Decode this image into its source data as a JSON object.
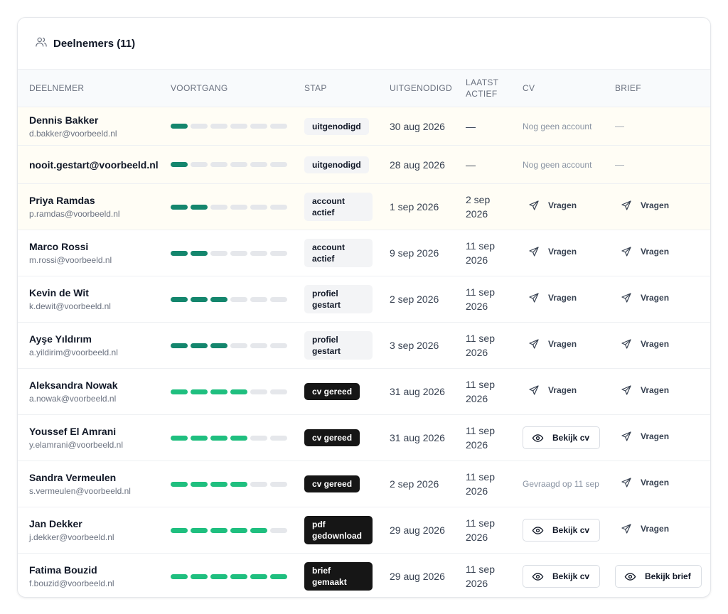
{
  "header": {
    "title": "Deelnemers (11)",
    "icon": "users-icon"
  },
  "columns": {
    "participant": "DEELNEMER",
    "progress": "VOORTGANG",
    "step": "STAP",
    "invited": "UITGENODIGD",
    "last_active_1": "LAATST",
    "last_active_2": "ACTIEF",
    "cv": "CV",
    "letter": "BRIEF"
  },
  "rows": [
    {
      "name": "Dennis Bakker",
      "email": "d.bakker@voorbeeld.nl",
      "progress": 1,
      "step": "uitgenodigd",
      "invited": "30 aug 2026",
      "last_active_1": "—",
      "last_active_2": "",
      "cv": "Nog geen account",
      "letter": "—"
    },
    {
      "name": "nooit.gestart@voorbeeld.nl",
      "email": "",
      "progress": 1,
      "step": "uitgenodigd",
      "invited": "28 aug 2026",
      "last_active_1": "—",
      "last_active_2": "",
      "cv": "Nog geen account",
      "letter": "—"
    },
    {
      "name": "Priya Ramdas",
      "email": "p.ramdas@voorbeeld.nl",
      "progress": 2,
      "step": "account actief",
      "invited": "1 sep 2026",
      "last_active_1": "2 sep",
      "last_active_2": "2026",
      "cv": "Vragen",
      "letter": "Vragen"
    },
    {
      "name": "Marco Rossi",
      "email": "m.rossi@voorbeeld.nl",
      "progress": 2,
      "step": "account actief",
      "invited": "9 sep 2026",
      "last_active_1": "11 sep",
      "last_active_2": "2026",
      "cv": "Vragen",
      "letter": "Vragen"
    },
    {
      "name": "Kevin de Wit",
      "email": "k.dewit@voorbeeld.nl",
      "progress": 3,
      "step": "profiel gestart",
      "invited": "2 sep 2026",
      "last_active_1": "11 sep",
      "last_active_2": "2026",
      "cv": "Vragen",
      "letter": "Vragen"
    },
    {
      "name": "Ayşe Yıldırım",
      "email": "a.yildirim@voorbeeld.nl",
      "progress": 3,
      "step": "profiel gestart",
      "invited": "3 sep 2026",
      "last_active_1": "11 sep",
      "last_active_2": "2026",
      "cv": "Vragen",
      "letter": "Vragen"
    },
    {
      "name": "Aleksandra Nowak",
      "email": "a.nowak@voorbeeld.nl",
      "progress": 4,
      "step": "cv gereed",
      "invited": "31 aug 2026",
      "last_active_1": "11 sep",
      "last_active_2": "2026",
      "cv": "Vragen",
      "letter": "Vragen"
    },
    {
      "name": "Youssef El Amrani",
      "email": "y.elamrani@voorbeeld.nl",
      "progress": 4,
      "step": "cv gereed",
      "invited": "31 aug 2026",
      "last_active_1": "11 sep",
      "last_active_2": "2026",
      "cv": "Bekijk cv",
      "letter": "Vragen"
    },
    {
      "name": "Sandra Vermeulen",
      "email": "s.vermeulen@voorbeeld.nl",
      "progress": 4,
      "step": "cv gereed",
      "invited": "2 sep 2026",
      "last_active_1": "11 sep",
      "last_active_2": "2026",
      "cv": "Gevraagd op 11 sep",
      "letter": "Vragen"
    },
    {
      "name": "Jan Dekker",
      "email": "j.dekker@voorbeeld.nl",
      "progress": 5,
      "step": "pdf gedownload",
      "invited": "29 aug 2026",
      "last_active_1": "11 sep",
      "last_active_2": "2026",
      "cv": "Bekijk cv",
      "letter": "Vragen"
    },
    {
      "name": "Fatima Bouzid",
      "email": "f.bouzid@voorbeeld.nl",
      "progress": 6,
      "step": "brief gemaakt",
      "invited": "29 aug 2026",
      "last_active_1": "11 sep",
      "last_active_2": "2026",
      "cv": "Bekijk cv",
      "letter": "Bekijk brief"
    }
  ],
  "progress_total": 6,
  "colors": {
    "progress_early": "#14866d",
    "progress_late": "#1fbf7f",
    "progress_empty": "#e5e7eb",
    "badge_dark": "#161616",
    "warning_row": "#fffdf5"
  }
}
